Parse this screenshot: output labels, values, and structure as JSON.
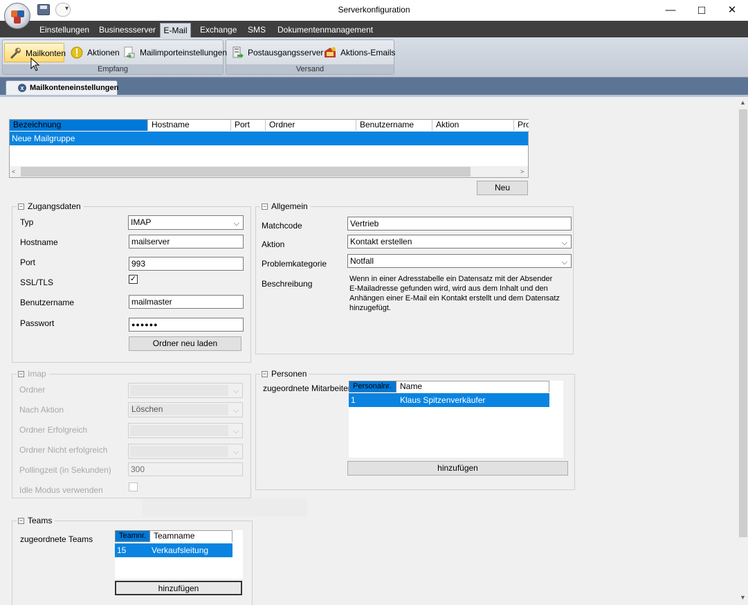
{
  "window": {
    "title": "Serverkonfiguration",
    "minimize": "—",
    "maximize": "☐",
    "close": "✕"
  },
  "ribbon": {
    "tabs": [
      "Einstellungen",
      "Businessserver",
      "E-Mail",
      "Exchange",
      "SMS",
      "Dokumentenmanagement"
    ],
    "active_tab": "E-Mail",
    "groups": {
      "empfang": {
        "label": "Empfang",
        "buttons": [
          "Mailkonten",
          "Aktionen",
          "Mailimporteinstellungen"
        ]
      },
      "versand": {
        "label": "Versand",
        "buttons": [
          "Postausgangsserver",
          "Aktions-Emails"
        ]
      }
    },
    "quick_access_dropdown": "▾"
  },
  "document_tab": {
    "label": "Mailkonteneinstellungen"
  },
  "accounts_grid": {
    "columns": [
      "Bezeichnung",
      "Hostname",
      "Port",
      "Ordner",
      "Benutzername",
      "Aktion",
      "Prol"
    ],
    "rows": [
      {
        "bezeichnung": "Neue Mailgruppe"
      }
    ],
    "new_button": "Neu"
  },
  "zugangsdaten": {
    "title": "Zugangsdaten",
    "typ_label": "Typ",
    "typ_value": "IMAP",
    "hostname_label": "Hostname",
    "hostname_value": "mailserver",
    "port_label": "Port",
    "port_value": "993",
    "ssl_label": "SSL/TLS",
    "ssl_checked": "✓",
    "benutzername_label": "Benutzername",
    "benutzername_value": "mailmaster",
    "passwort_label": "Passwort",
    "passwort_value": "●●●●●●",
    "reload_button": "Ordner neu laden"
  },
  "allgemein": {
    "title": "Allgemein",
    "matchcode_label": "Matchcode",
    "matchcode_value": "Vertrieb",
    "aktion_label": "Aktion",
    "aktion_value": "Kontakt erstellen",
    "problemkategorie_label": "Problemkategorie",
    "problemkategorie_value": "Notfall",
    "beschreibung_label": "Beschreibung",
    "beschreibung_lines": [
      "Wenn in einer Adresstabelle ein Datensatz mit der Absender",
      "E-Mailadresse gefunden wird, wird aus dem Inhalt und den",
      "Anhängen einer E-Mail ein Kontakt erstellt und dem Datensatz",
      "hinzugefügt."
    ]
  },
  "imap": {
    "title": "Imap",
    "ordner_label": "Ordner",
    "nach_aktion_label": "Nach Aktion",
    "nach_aktion_value": "Löschen",
    "ordner_erfolgreich_label": "Ordner Erfolgreich",
    "ordner_nicht_label": "Ordner Nicht erfolgreich",
    "polling_label": "Pollingzeit (in Sekunden)",
    "polling_value": "300",
    "idle_label": "Idle Modus verwenden"
  },
  "personen": {
    "title": "Personen",
    "mitarbeiter_label": "zugeordnete Mitarbeiter",
    "columns": [
      "Personalnr.",
      "Name"
    ],
    "rows": [
      {
        "nr": "1",
        "name": "Klaus Spitzenverkäufer"
      }
    ],
    "add_button": "hinzufügen"
  },
  "teams": {
    "title": "Teams",
    "teams_label": "zugeordnete Teams",
    "columns": [
      "Teamnr.",
      "Teamname"
    ],
    "rows": [
      {
        "nr": "15",
        "name": "Verkaufsleitung"
      }
    ],
    "add_button": "hinzufügen"
  },
  "icons": {
    "chevron": "⌵",
    "scroll_up": "▲",
    "scroll_down": "▼",
    "scroll_left": "<",
    "scroll_right": ">",
    "collapse": "−",
    "tab_close": "x"
  }
}
